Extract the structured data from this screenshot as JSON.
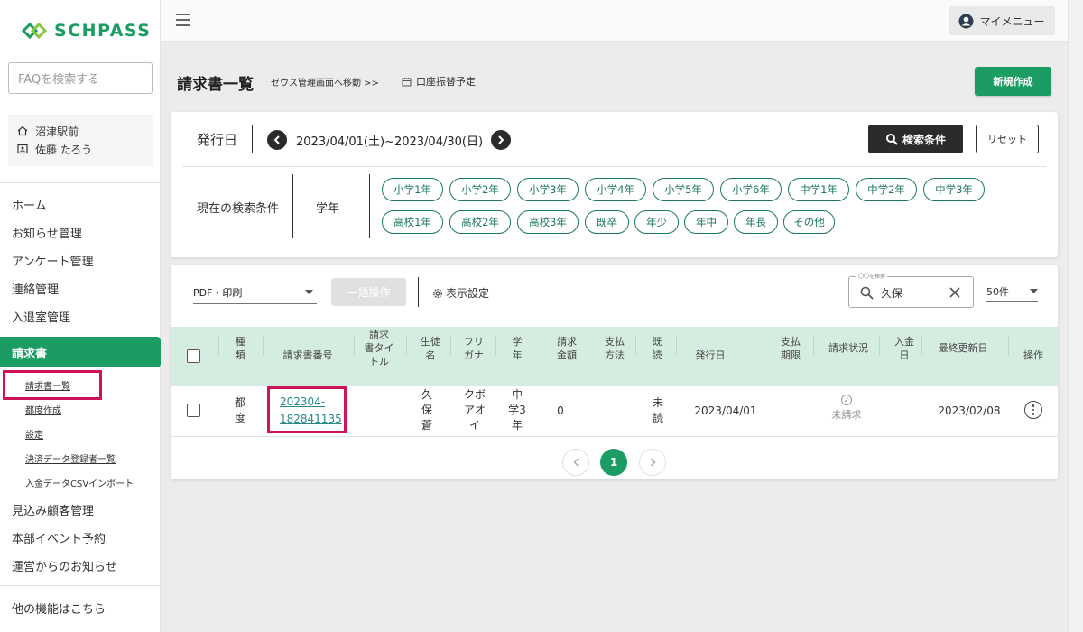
{
  "app": {
    "logo_text": "SCHPASS"
  },
  "sidebar": {
    "faq_placeholder": "FAQを検索する",
    "location": "沼津駅前",
    "user": "佐藤 たろう",
    "nav": [
      "ホーム",
      "お知らせ管理",
      "アンケート管理",
      "連絡管理",
      "入退室管理"
    ],
    "active": "請求書",
    "sub": [
      "請求書一覧",
      "都度作成",
      "設定",
      "決済データ登録者一覧",
      "入金データCSVインポート"
    ],
    "nav2": [
      "見込み顧客管理",
      "本部イベント予約",
      "運営からのお知らせ"
    ],
    "more": "他の機能はこちら"
  },
  "topbar": {
    "mymenu": "マイメニュー"
  },
  "header": {
    "title": "請求書一覧",
    "zeus_link": "ゼウス管理画面へ移動 >>",
    "transfer": "口座振替予定",
    "new_button": "新規作成"
  },
  "filter": {
    "issue_label": "発行日",
    "date_range": "2023/04/01(土)~2023/04/30(日)",
    "search_button": "検索条件",
    "reset_button": "リセット",
    "current_label": "現在の検索条件",
    "grade_label": "学年",
    "chips_row1": [
      "小学1年",
      "小学2年",
      "小学3年",
      "小学4年",
      "小学5年",
      "小学6年",
      "中学1年",
      "中学2年",
      "中学3年"
    ],
    "chips_row2": [
      "高校1年",
      "高校2年",
      "高校3年",
      "既卒",
      "年少",
      "年中",
      "年長",
      "その他"
    ]
  },
  "list": {
    "pdf_select": "PDF・印刷",
    "bulk_button": "一括操作",
    "display_settings": "表示設定",
    "search_legend": "〇〇を検索",
    "search_value": "久保",
    "page_size": "50件",
    "columns": {
      "kind": "種\n類",
      "number": "請求書番号",
      "title": "請求\n書タイ\nトル",
      "student": "生徒\n名",
      "kana": "フリ\nガナ",
      "grade": "学\n年",
      "amount": "請求\n金額",
      "method": "支払\n方法",
      "read": "既\n読",
      "issued": "発行日",
      "due": "支払\n期限",
      "status": "請求状況",
      "paid": "入金\n日",
      "updated": "最終更新日",
      "ops": "操作"
    },
    "rows": [
      {
        "kind": "都\n度",
        "number": "202304-\n182841135",
        "student": "久\n保\n蒼",
        "kana": "クボ\nアオ\nイ",
        "grade": "中\n学3\n年",
        "amount": "0",
        "read": "未\n読",
        "issued": "2023/04/01",
        "status": "未請求",
        "updated": "2023/02/08"
      }
    ],
    "pagination": {
      "current": "1"
    }
  },
  "colors": {
    "brand": "#1a9c63",
    "highlight": "#d0145a",
    "header_bg": "#d5ede1"
  }
}
